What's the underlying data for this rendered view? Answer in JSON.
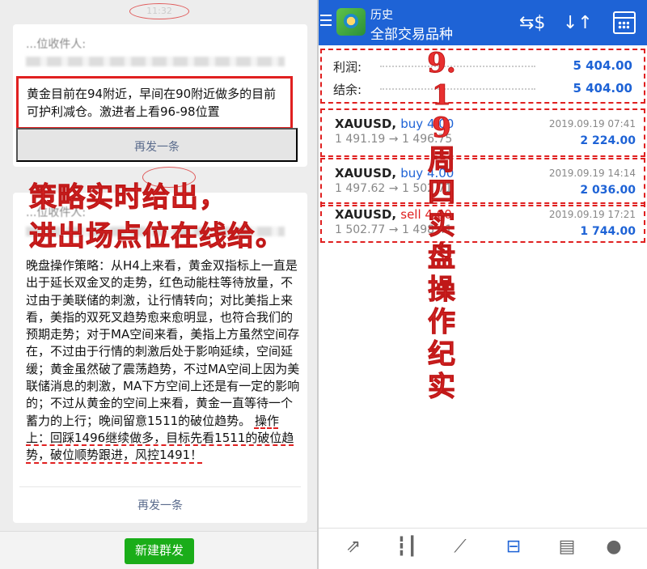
{
  "left": {
    "time1": "11:32",
    "recipient_label": "...位收件人:",
    "message1": "黄金目前在94附近，早间在90附近做多的目前可护利减仓。激进者上看96-98位置",
    "resend_label": "再发一条",
    "overlay_line1": "策略实时给出，",
    "overlay_line2": "进出场点位在线给。",
    "recipient_label2": "...位收件人:",
    "message2_main": "晚盘操作策略：从H4上来看，黄金双指标上一直是出于延长双金叉的走势，红色动能柱等待放量，不过由于美联储的刺激，让行情转向；对比美指上来看，美指的双死叉趋势愈来愈明显，也符合我们的预期走势；对于MA空间来看，美指上方虽然空间存在，不过由于行情的刺激后处于影响延续，空间延缓；黄金虽然破了震荡趋势，不过MA空间上因为美联储消息的刺激，MA下方空间上还是有一定的影响的；不过从黄金的空间上来看，黄金一直等待一个蓄力的上行；晚间留意1511的破位趋势。",
    "message2_op": "操作上：回踩1496继续做多，目标先看1511的破位趋势，破位顺势跟进，风控1491！",
    "resend_label2": "再发一条",
    "new_button": "新建群发"
  },
  "right": {
    "appbar": {
      "title_small": "历史",
      "title_large": "全部交易品种"
    },
    "summary": {
      "profit_label": "利润:",
      "profit_value": "5 404.00",
      "balance_label": "结余:",
      "balance_value": "5 404.00"
    },
    "vertical_overlay": "9.19周四实盘操作纪实",
    "trades": [
      {
        "symbol": "XAUUSD,",
        "side": "buy 4.00",
        "date": "2019.09.19 07:41",
        "price": "1 491.19 → 1 496.75",
        "profit": "2 224.00"
      },
      {
        "symbol": "XAUUSD,",
        "side": "buy 4.00",
        "date": "2019.09.19 14:14",
        "price": "1 497.62 → 1 502.71",
        "profit": "2 036.00"
      },
      {
        "symbol": "XAUUSD,",
        "side": "sell 4.00",
        "date": "2019.09.19 17:21",
        "price": "1 502.77 → 1 498.41",
        "profit": "1 744.00"
      }
    ],
    "nav_icons": [
      "trade-arrows-icon",
      "candles-icon",
      "chart-line-icon",
      "history-inbox-icon",
      "news-icon",
      "chat-icon"
    ]
  },
  "colors": {
    "accent_blue": "#1e63d6",
    "annotation_red": "#e02020",
    "wechat_green": "#1aad19"
  }
}
